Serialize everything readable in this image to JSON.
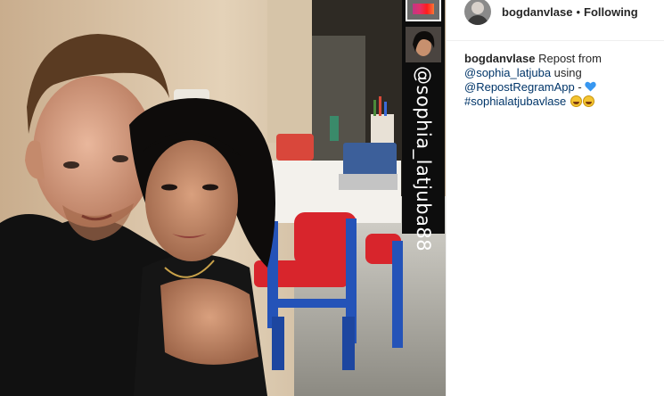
{
  "post": {
    "photo": {
      "repost_handle": "@sophia_latjuba88"
    },
    "header": {
      "username": "bogdanvlase",
      "separator": "•",
      "follow_status": "Following"
    },
    "caption": {
      "username": "bogdanvlase",
      "text_before": "Repost from",
      "mention_source": "@sophia_latjuba",
      "text_using": "using",
      "mention_app": "@RepostRegramApp",
      "text_dash": "-",
      "hashtag": "#sophialatjubavlase"
    },
    "colors": {
      "link": "#003569",
      "text": "#262626",
      "heart": "#3897f0"
    },
    "icons": [
      "blue-heart-icon",
      "kissing-face-icon",
      "grinning-face-icon"
    ]
  }
}
